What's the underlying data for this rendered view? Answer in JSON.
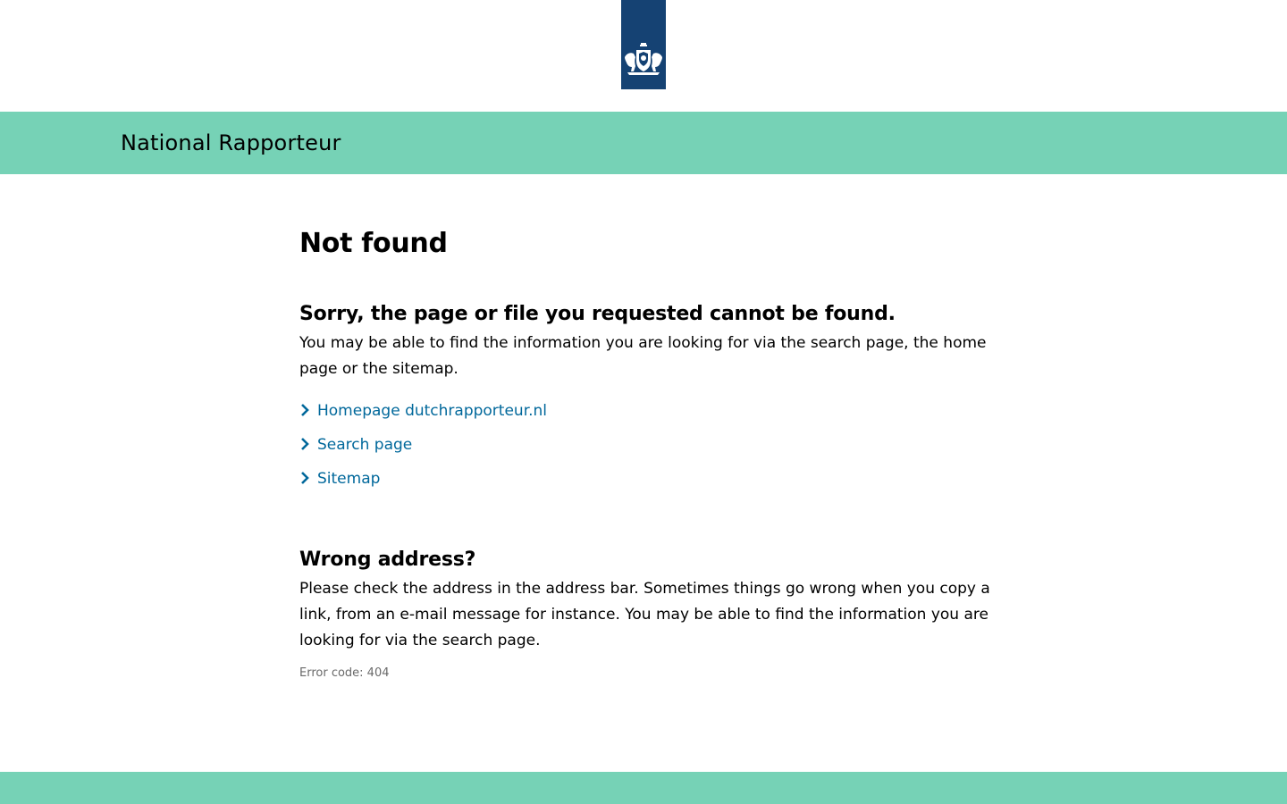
{
  "colors": {
    "logo_ribbon": "#154273",
    "brand_bar": "#76d2b6",
    "link": "#01689b",
    "muted": "#696969"
  },
  "header": {
    "logo_icon": "coat-of-arms-icon",
    "site_title": "National Rapporteur"
  },
  "main": {
    "title": "Not found",
    "sorry": {
      "heading": "Sorry, the page or file you requested cannot be found.",
      "text": "You may be able to find the information you are looking for via the search page, the home page or the sitemap."
    },
    "links": [
      {
        "label": "Homepage dutchrapporteur.nl",
        "icon": "chevron-right-icon"
      },
      {
        "label": "Search page",
        "icon": "chevron-right-icon"
      },
      {
        "label": "Sitemap",
        "icon": "chevron-right-icon"
      }
    ],
    "wrong_address": {
      "heading": "Wrong address?",
      "text": "Please check the address in the address bar. Sometimes things go wrong when you copy a link, from an e-mail message for instance. You may be able to find the information you are looking for via the search page."
    },
    "error_code": "Error code: 404"
  }
}
